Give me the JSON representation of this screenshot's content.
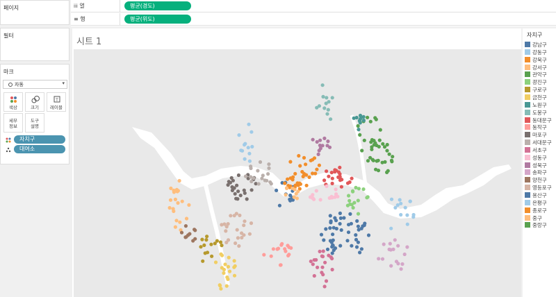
{
  "sidebar": {
    "pages_title": "페이지",
    "filters_title": "필터",
    "marks_title": "마크",
    "mark_type": "자동",
    "buttons": [
      {
        "label": "색상",
        "icon": "color-dots-icon"
      },
      {
        "label": "크기",
        "icon": "size-icon"
      },
      {
        "label": "레이블",
        "icon": "label-icon"
      },
      {
        "label": "세부\n정보",
        "icon": "detail-icon"
      },
      {
        "label": "도구\n설명",
        "icon": "tooltip-icon"
      }
    ],
    "mark_pills": [
      {
        "label": "자치구",
        "icon": "color-dots-icon"
      },
      {
        "label": "대여소",
        "icon": "detail-dots-icon"
      }
    ]
  },
  "shelves": {
    "columns": {
      "label": "열",
      "pill": "평균(경도)"
    },
    "rows": {
      "label": "행",
      "pill": "평균(위도)"
    }
  },
  "sheet": {
    "title": "시트 1"
  },
  "legend": {
    "title": "자치구",
    "items": [
      {
        "label": "강남구",
        "color": "#4e79a7"
      },
      {
        "label": "강동구",
        "color": "#a0cbe8"
      },
      {
        "label": "강북구",
        "color": "#f28e2b"
      },
      {
        "label": "강서구",
        "color": "#ffbe7d"
      },
      {
        "label": "관악구",
        "color": "#59a14f"
      },
      {
        "label": "광진구",
        "color": "#8cd17d"
      },
      {
        "label": "구로구",
        "color": "#b6992d"
      },
      {
        "label": "금천구",
        "color": "#f1ce63"
      },
      {
        "label": "노원구",
        "color": "#499894"
      },
      {
        "label": "도봉구",
        "color": "#86bcb6"
      },
      {
        "label": "동대문구",
        "color": "#e15759"
      },
      {
        "label": "동작구",
        "color": "#ff9d9a"
      },
      {
        "label": "마포구",
        "color": "#79706e"
      },
      {
        "label": "서대문구",
        "color": "#bab0ac"
      },
      {
        "label": "서초구",
        "color": "#d37295"
      },
      {
        "label": "성동구",
        "color": "#fabfd2"
      },
      {
        "label": "성북구",
        "color": "#b07aa1"
      },
      {
        "label": "송파구",
        "color": "#d4a6c8"
      },
      {
        "label": "양천구",
        "color": "#9d7660"
      },
      {
        "label": "영등포구",
        "color": "#d7b5a6"
      },
      {
        "label": "용산구",
        "color": "#4e79a7"
      },
      {
        "label": "은평구",
        "color": "#a0cbe8"
      },
      {
        "label": "종로구",
        "color": "#f28e2b"
      },
      {
        "label": "중구",
        "color": "#ffbe7d"
      },
      {
        "label": "중랑구",
        "color": "#59a14f"
      }
    ]
  }
}
